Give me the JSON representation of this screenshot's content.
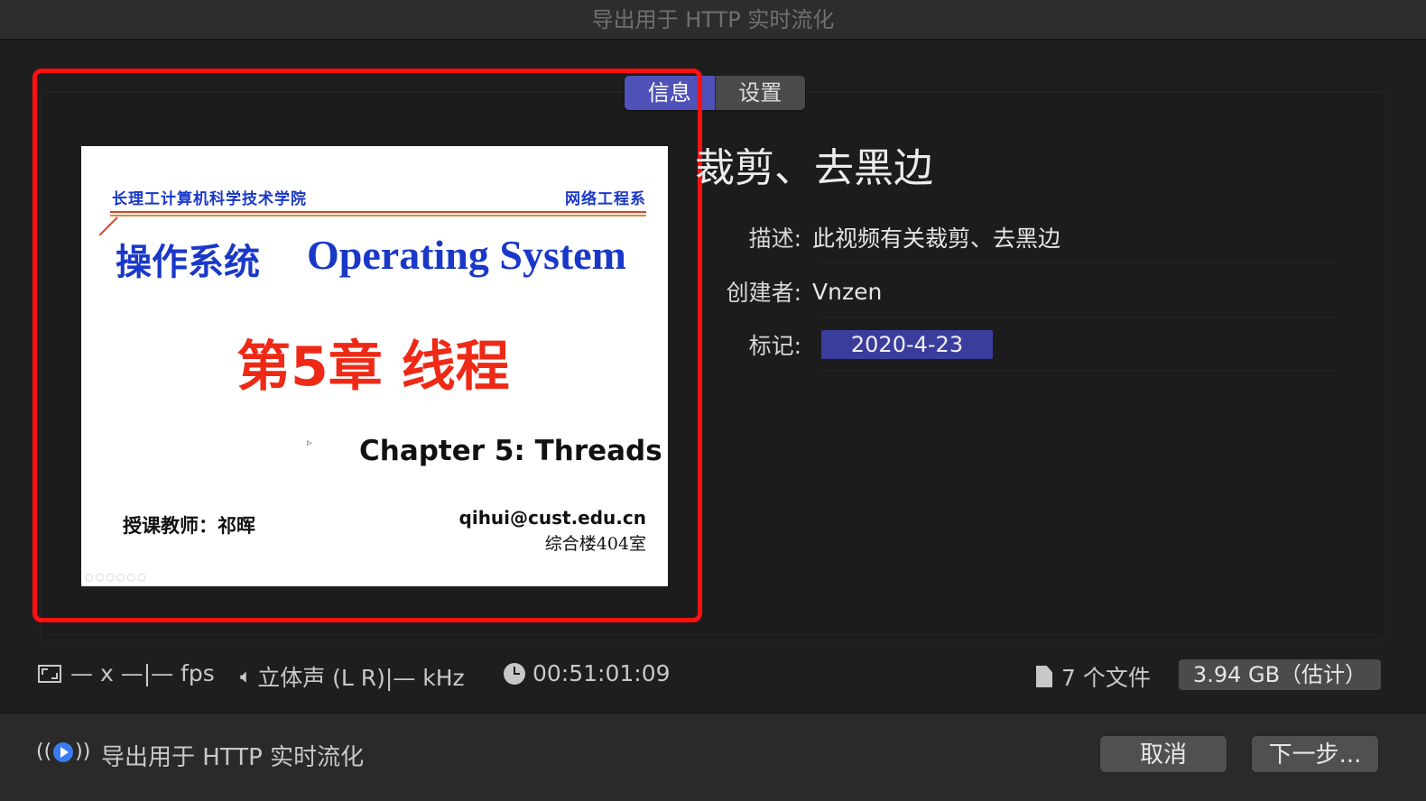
{
  "window": {
    "title": "导出用于 HTTP 实时流化"
  },
  "tabs": [
    {
      "label": "信息",
      "active": true
    },
    {
      "label": "设置",
      "active": false
    }
  ],
  "preview": {
    "dept_left": "长理工计算机科学技术学院",
    "dept_right": "网络工程系",
    "cn_title": "操作系统",
    "en_title": "Operating System",
    "chapter_cn": "第5章 线程",
    "chapter_en": "Chapter 5: Threads",
    "teacher": "授课教师：祁晖",
    "email": "qihui@cust.edu.cn",
    "room": "综合楼404室"
  },
  "info": {
    "title": "裁剪、去黑边",
    "fields": [
      {
        "label": "描述:",
        "value": "此视频有关裁剪、去黑边"
      },
      {
        "label": "创建者:",
        "value": "Vnzen"
      },
      {
        "label": "标记:",
        "value": "2020-4-23"
      }
    ]
  },
  "status": {
    "resolution": "— x —|— fps",
    "audio": "立体声 (L R)|— kHz",
    "duration": "00:51:01:09",
    "files": "7 个文件",
    "size": "3.94 GB（估计）"
  },
  "footer": {
    "destination": "导出用于 HTTP 实时流化",
    "cancel": "取消",
    "next": "下一步..."
  },
  "colors": {
    "accent": "#4f52b8",
    "tag": "#3b3d9c",
    "highlight": "#ff1010"
  }
}
